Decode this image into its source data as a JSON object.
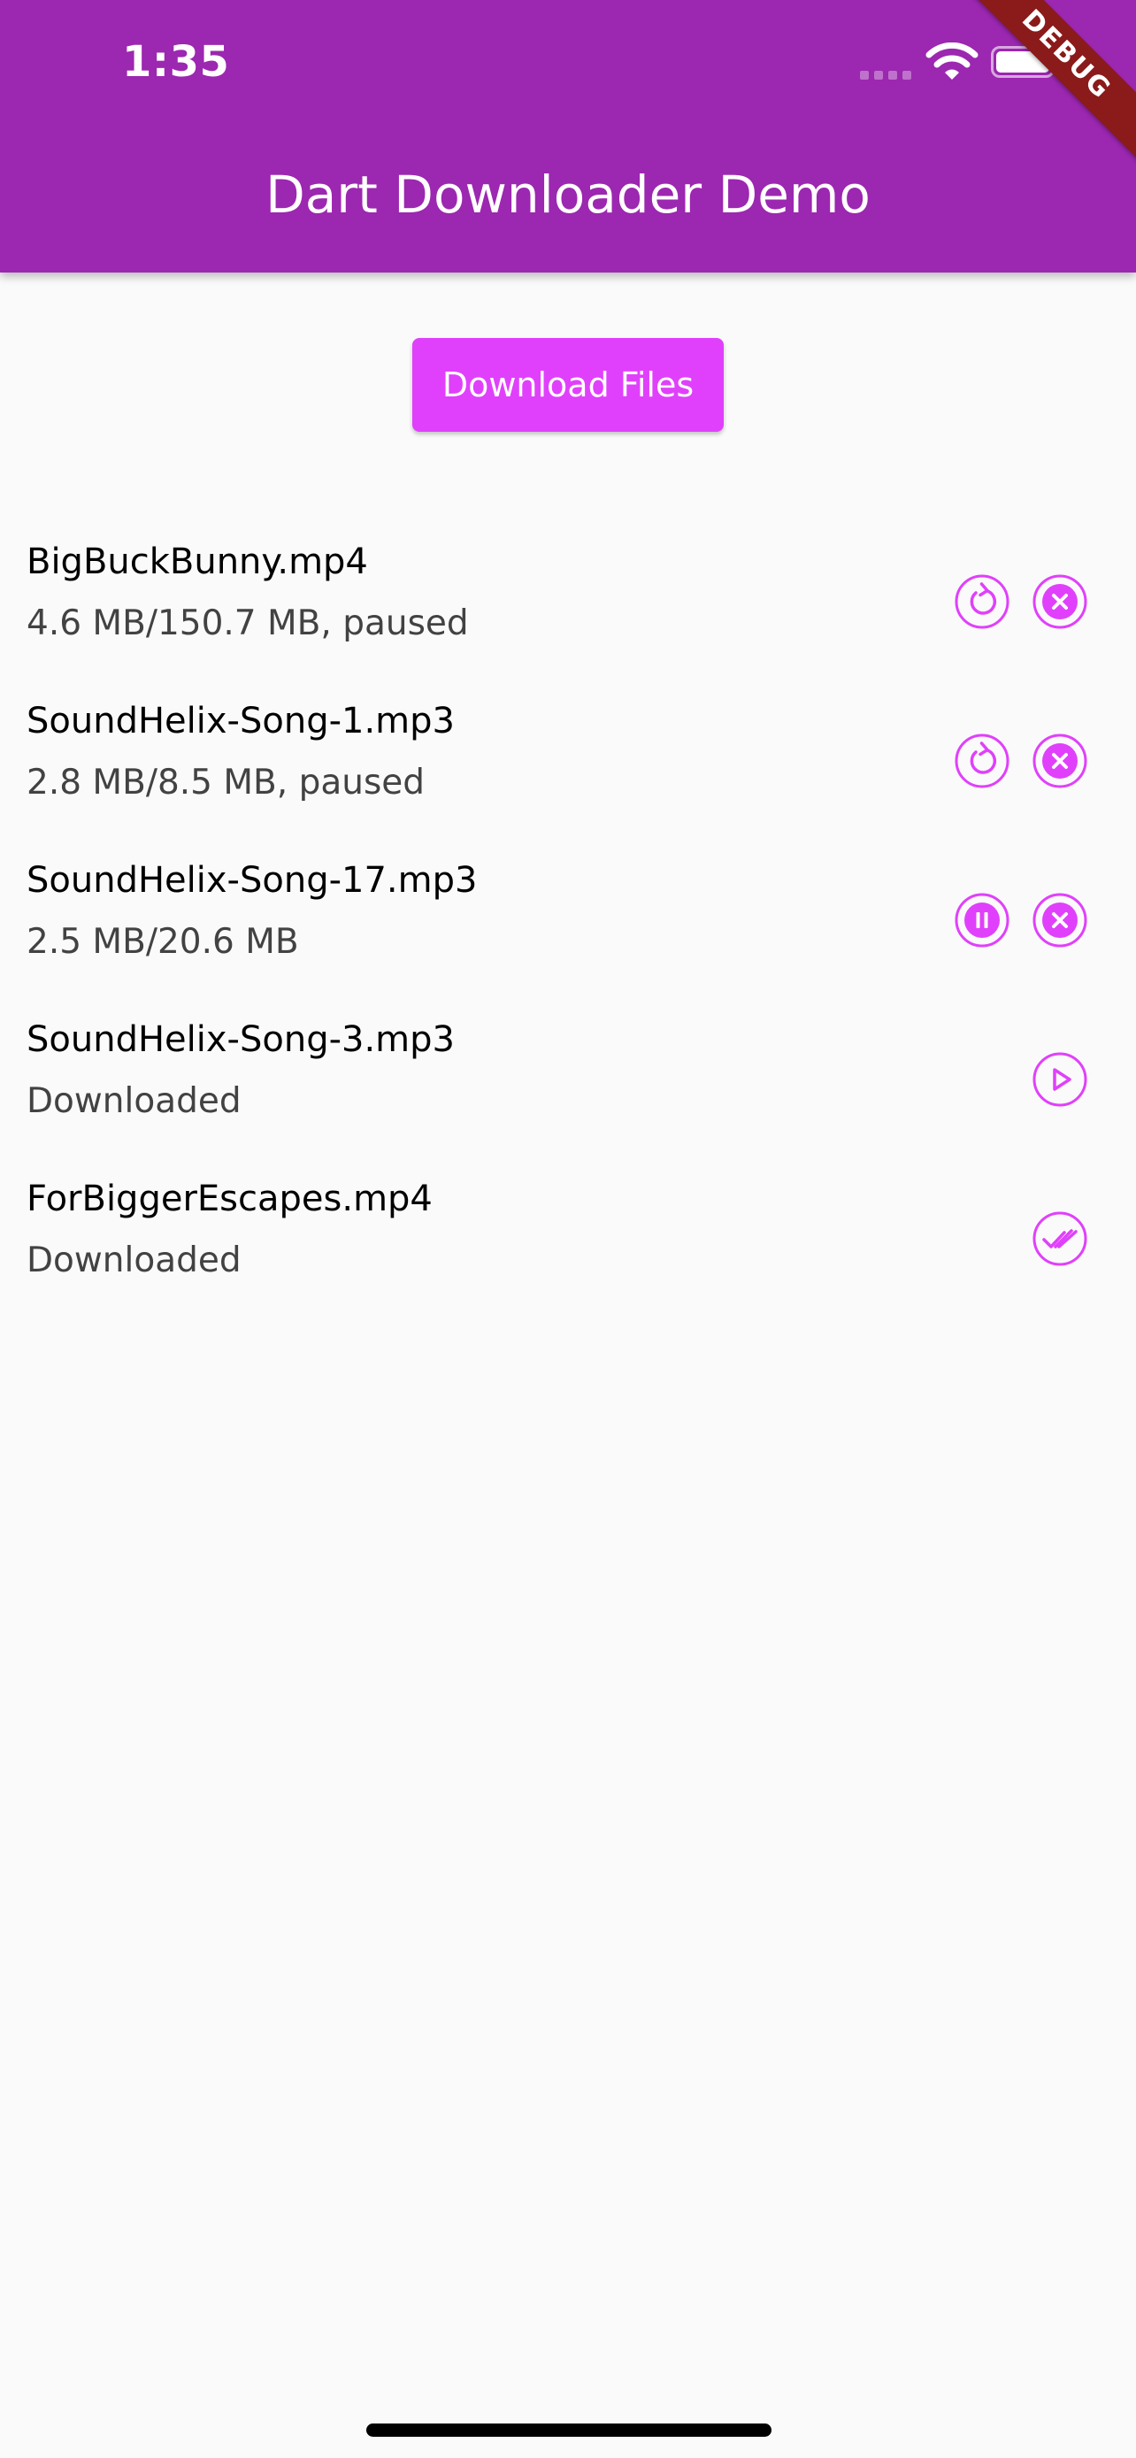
{
  "status_bar": {
    "time": "1:35"
  },
  "app_bar": {
    "title": "Dart Downloader Demo",
    "debug_banner": "DEBUG",
    "background": "#9c27b0"
  },
  "accent_color": "#e040fb",
  "download_button": {
    "label": "Download Files"
  },
  "downloads": [
    {
      "name": "BigBuckBunny.mp4",
      "status": "4.6 MB/150.7 MB, paused",
      "actions": [
        "restart-icon",
        "cancel-icon"
      ]
    },
    {
      "name": "SoundHelix-Song-1.mp3",
      "status": "2.8 MB/8.5 MB, paused",
      "actions": [
        "restart-icon",
        "cancel-icon"
      ]
    },
    {
      "name": "SoundHelix-Song-17.mp3",
      "status": "2.5 MB/20.6 MB",
      "actions": [
        "pause-icon",
        "cancel-icon"
      ]
    },
    {
      "name": "SoundHelix-Song-3.mp3",
      "status": "Downloaded",
      "actions": [
        "play-icon"
      ]
    },
    {
      "name": "ForBiggerEscapes.mp4",
      "status": "Downloaded",
      "actions": [
        "done-all-icon"
      ]
    }
  ]
}
